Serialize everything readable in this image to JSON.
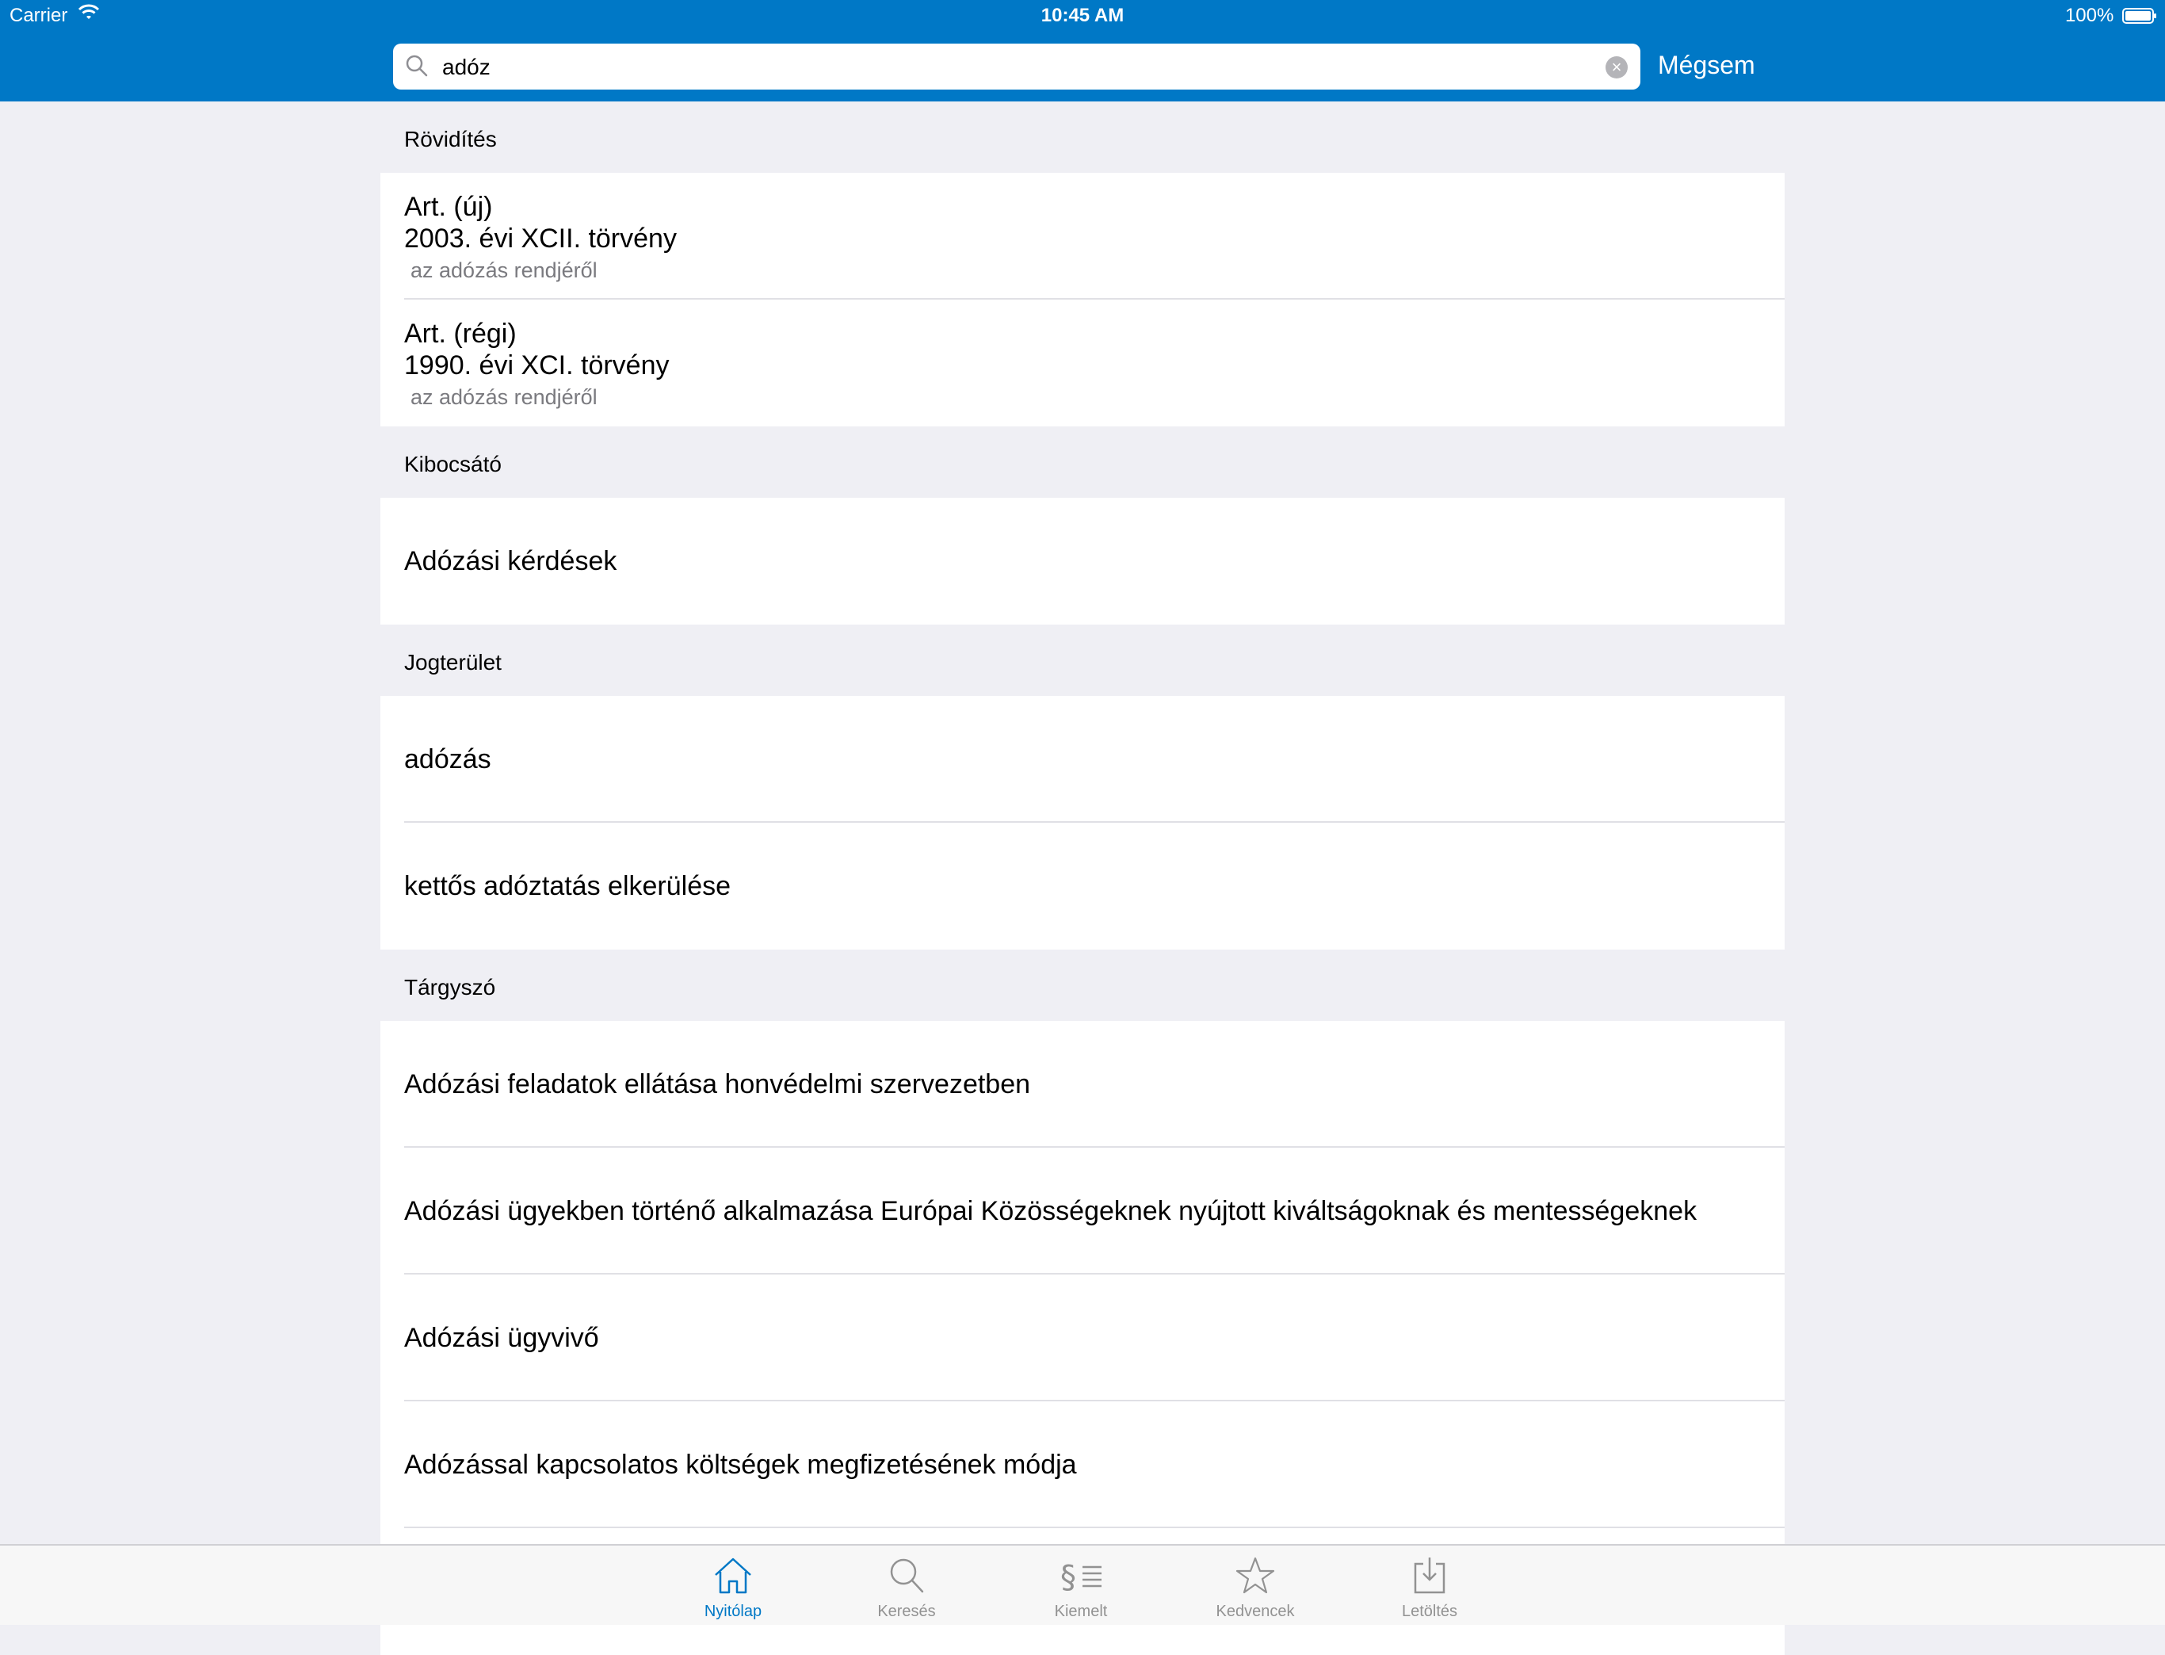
{
  "status": {
    "carrier": "Carrier",
    "time": "10:45 AM",
    "battery": "100%"
  },
  "search": {
    "query": "adóz",
    "cancel_label": "Mégsem"
  },
  "sections": {
    "rovidites": {
      "header": "Rövidítés",
      "items": [
        {
          "abbr": "Art. (új)",
          "law": "2003. évi XCII. törvény",
          "desc": "az adózás rendjéről"
        },
        {
          "abbr": "Art. (régi)",
          "law": "1990. évi XCI. törvény",
          "desc": "az adózás rendjéről"
        }
      ]
    },
    "kibocsato": {
      "header": "Kibocsátó",
      "items": [
        "Adózási kérdések"
      ]
    },
    "jogterulet": {
      "header": "Jogterület",
      "items": [
        "adózás",
        "kettős adóztatás elkerülése"
      ]
    },
    "targyszo": {
      "header": "Tárgyszó",
      "items": [
        "Adózási feladatok ellátása honvédelmi szervezetben",
        "Adózási ügyekben történő alkalmazása Európai Közösségeknek nyújtott kiváltságoknak és mentességeknek",
        "Adózási ügyvivő",
        "Adózással kapcsolatos költségek megfizetésének módja"
      ]
    }
  },
  "tabs": [
    {
      "label": "Nyitólap",
      "icon": "home-icon",
      "active": true
    },
    {
      "label": "Keresés",
      "icon": "search-icon",
      "active": false
    },
    {
      "label": "Kiemelt",
      "icon": "paragraph-icon",
      "active": false
    },
    {
      "label": "Kedvencek",
      "icon": "star-icon",
      "active": false
    },
    {
      "label": "Letöltés",
      "icon": "download-icon",
      "active": false
    }
  ],
  "colors": {
    "accent": "#0078c6",
    "background": "#efeff4",
    "secondary_text": "#7a7a7f",
    "tab_inactive": "#929292"
  }
}
